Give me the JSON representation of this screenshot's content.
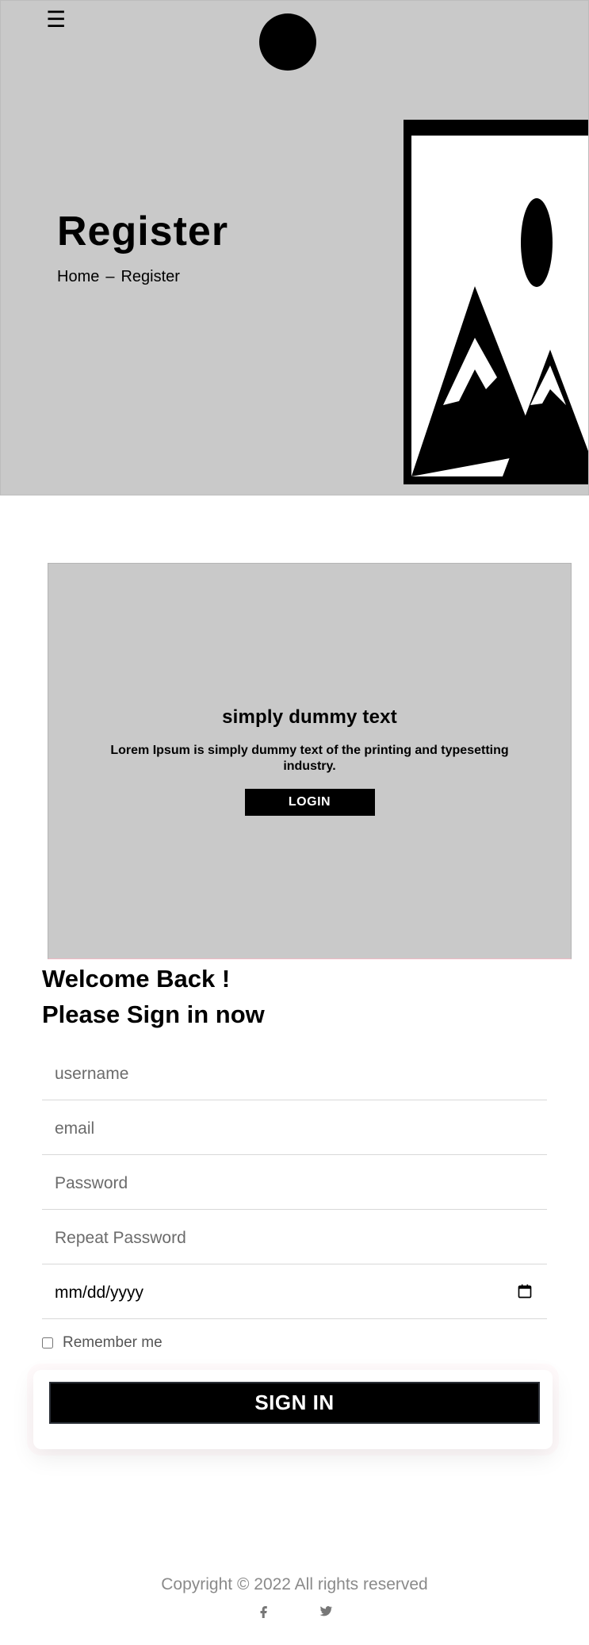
{
  "header": {
    "menu_icon": "hamburger-icon",
    "logo_icon": "circle-logo",
    "hero_title": "Register",
    "breadcrumb": {
      "items": [
        "Home",
        "Register"
      ],
      "separator": "–"
    },
    "hero_image_icon": "image-placeholder-icon"
  },
  "promo": {
    "title": "simply dummy text",
    "text": "Lorem Ipsum is simply dummy text of the printing and typesetting industry.",
    "button_label": "LOGIN"
  },
  "signin": {
    "welcome_line1": "Welcome Back !",
    "welcome_line2": "Please Sign in now",
    "fields": {
      "username_placeholder": "username",
      "email_placeholder": "email",
      "password_placeholder": "Password",
      "repeat_password_placeholder": "Repeat Password",
      "date_value": "mm/dd/yyyy"
    },
    "remember_label": "Remember me",
    "submit_label": "SIGN IN"
  },
  "footer": {
    "copyright": "Copyright © 2022 All rights reserved",
    "socials": [
      "facebook-icon",
      "twitter-icon"
    ]
  },
  "colors": {
    "hero_bg": "#c9c9c9",
    "card_bg": "#c9c9c9",
    "button_bg": "#000000",
    "text_primary": "#000000",
    "text_muted": "#8a8a8a"
  }
}
